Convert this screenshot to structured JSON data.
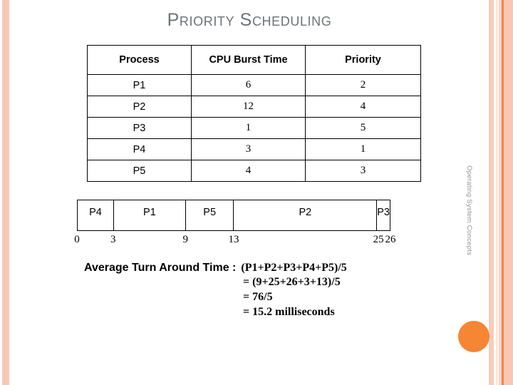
{
  "slide": {
    "title": "Priority Scheduling",
    "side_caption": "Operating System Concepts",
    "accent_color": "#f58634",
    "stripe_color": "#f8c8b4",
    "title_color": "#6d7278"
  },
  "table": {
    "headers": [
      "Process",
      "CPU Burst Time",
      "Priority"
    ],
    "rows": [
      {
        "process": "P1",
        "burst": "6",
        "priority": "2"
      },
      {
        "process": "P2",
        "burst": "12",
        "priority": "4"
      },
      {
        "process": "P3",
        "burst": "1",
        "priority": "5"
      },
      {
        "process": "P4",
        "burst": "3",
        "priority": "1"
      },
      {
        "process": "P5",
        "burst": "4",
        "priority": "3"
      }
    ]
  },
  "gantt": {
    "segments": [
      {
        "label": "P4",
        "start": "0",
        "end": "3"
      },
      {
        "label": "P1",
        "start": "3",
        "end": "9"
      },
      {
        "label": "P5",
        "start": "9",
        "end": "13"
      },
      {
        "label": "P2",
        "start": "13",
        "end": "25"
      },
      {
        "label": "P3",
        "start": "25",
        "end": "26"
      }
    ],
    "ticks": [
      "0",
      "3",
      "9",
      "13",
      "25",
      "26"
    ]
  },
  "calculation": {
    "label": "Average Turn Around Time :",
    "line1": "(P1+P2+P3+P4+P5)/5",
    "line2": "= (9+25+26+3+13)/5",
    "line3": "= 76/5",
    "line4": "= 15.2 milliseconds"
  }
}
